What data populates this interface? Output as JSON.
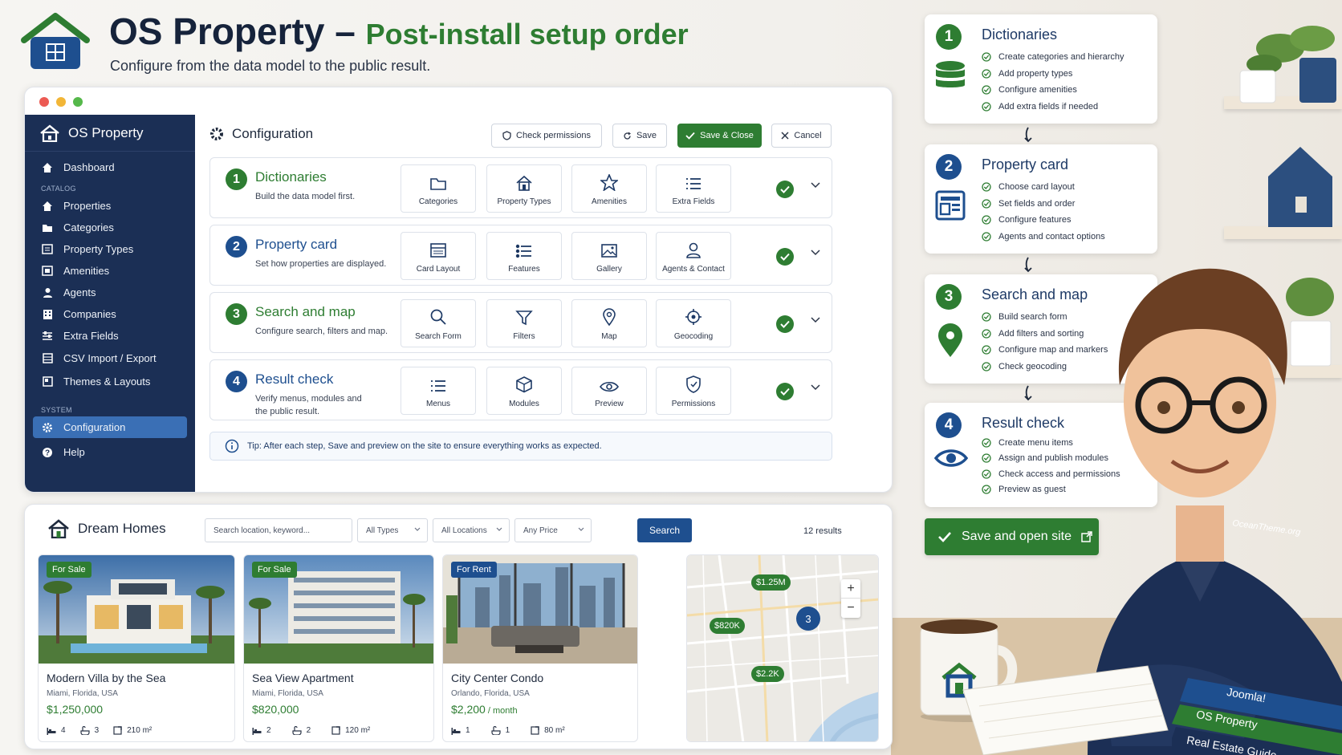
{
  "header": {
    "title": "OS Property",
    "dash": "–",
    "subtitle": "Post-install setup order",
    "tagline": "Configure from the data model to the public result."
  },
  "sidebar": {
    "brand": "OS Property",
    "dashboard": "Dashboard",
    "catalog_label": "CATALOG",
    "catalog": [
      "Properties",
      "Categories",
      "Property Types",
      "Amenities",
      "Agents",
      "Companies",
      "Extra Fields",
      "CSV Import / Export",
      "Themes & Layouts"
    ],
    "system_label": "SYSTEM",
    "configuration": "Configuration",
    "help": "Help"
  },
  "config": {
    "title": "Configuration",
    "buttons": {
      "check": "Check permissions",
      "save": "Save",
      "save_close": "Save & Close",
      "cancel": "Cancel"
    },
    "steps": [
      {
        "num": "1",
        "title": "Dictionaries",
        "desc": "Build the data model first.",
        "tiles": [
          "Categories",
          "Property Types",
          "Amenities",
          "Extra Fields"
        ]
      },
      {
        "num": "2",
        "title": "Property card",
        "desc": "Set how properties are displayed.",
        "tiles": [
          "Card Layout",
          "Features",
          "Gallery",
          "Agents & Contact"
        ]
      },
      {
        "num": "3",
        "title": "Search and map",
        "desc": "Configure search, filters and map.",
        "tiles": [
          "Search Form",
          "Filters",
          "Map",
          "Geocoding"
        ]
      },
      {
        "num": "4",
        "title": "Result check",
        "desc": "Verify menus, modules and the public result.",
        "tiles": [
          "Menus",
          "Modules",
          "Preview",
          "Permissions"
        ]
      }
    ],
    "tip": "Tip: After each step, Save and preview on the site to ensure everything works as expected."
  },
  "dream": {
    "title": "Dream Homes",
    "search_placeholder": "Search location, keyword...",
    "types": "All Types",
    "locations": "All Locations",
    "price": "Any Price",
    "search_btn": "Search",
    "results": "12 results",
    "cards": [
      {
        "tag": "For Sale",
        "name": "Modern Villa by the Sea",
        "loc": "Miami, Florida, USA",
        "price": "$1,250,000",
        "per": "",
        "beds": "4",
        "baths": "3",
        "area": "210 m²"
      },
      {
        "tag": "For Sale",
        "name": "Sea View Apartment",
        "loc": "Miami, Florida, USA",
        "price": "$820,000",
        "per": "",
        "beds": "2",
        "baths": "2",
        "area": "120 m²"
      },
      {
        "tag": "For Rent",
        "name": "City Center Condo",
        "loc": "Orlando, Florida, USA",
        "price": "$2,200",
        "per": " / month",
        "beds": "1",
        "baths": "1",
        "area": "80 m²"
      }
    ],
    "map_pins": [
      "$1.25M",
      "$820K",
      "3",
      "$2.2K"
    ],
    "zoom_in": "+",
    "zoom_out": "−"
  },
  "right_steps": [
    {
      "num": "1",
      "title": "Dictionaries",
      "items": [
        "Create categories and hierarchy",
        "Add property types",
        "Configure amenities",
        "Add extra fields if needed"
      ]
    },
    {
      "num": "2",
      "title": "Property card",
      "items": [
        "Choose card layout",
        "Set fields and order",
        "Configure features",
        "Agents and contact options"
      ]
    },
    {
      "num": "3",
      "title": "Search and map",
      "items": [
        "Build search form",
        "Add filters and sorting",
        "Configure map and markers",
        "Check geocoding"
      ]
    },
    {
      "num": "4",
      "title": "Result check",
      "items": [
        "Create menu items",
        "Assign and publish modules",
        "Check access and permissions",
        "Preview as guest"
      ]
    }
  ],
  "cta": "Save and open site",
  "books": [
    "Joomla!",
    "OS Property",
    "Real Estate Guide"
  ],
  "shirt_text": "OceanTheme.org",
  "colors": {
    "navy": "#1b2f55",
    "green": "#2e7d32",
    "blue": "#1e4f8f"
  }
}
